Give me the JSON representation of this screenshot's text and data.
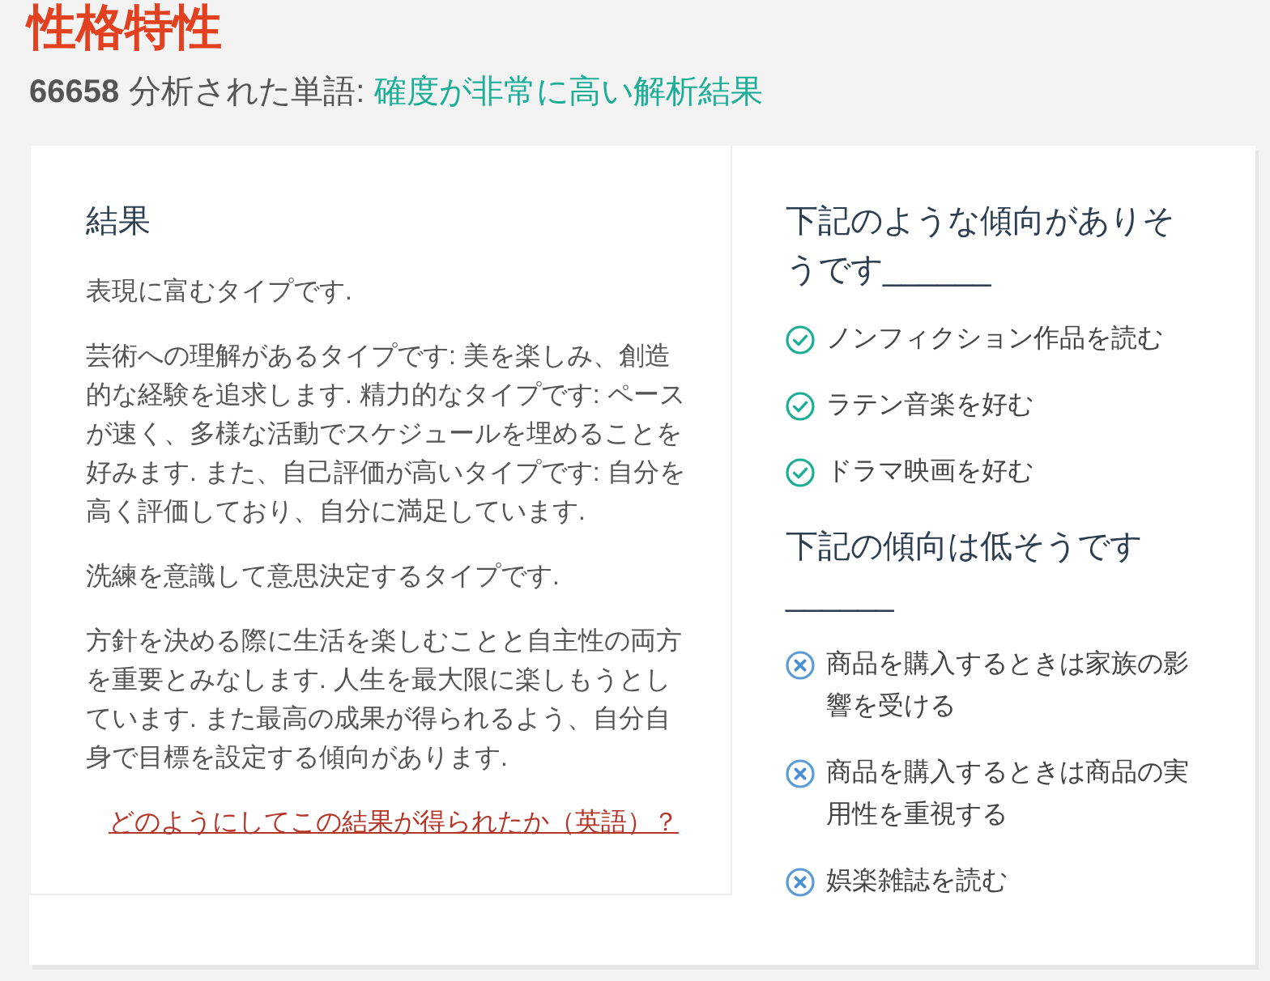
{
  "title": "性格特性",
  "summary": {
    "count": "66658",
    "label": "分析された単語:",
    "confidence": "確度が非常に高い解析結果"
  },
  "result": {
    "heading": "結果",
    "paragraphs": [
      "表現に富むタイプです.",
      "芸術への理解があるタイプです: 美を楽しみ、創造的な経験を追求します. 精力的なタイプです: ペースが速く、多様な活動でスケジュールを埋めることを好みます. また、自己評価が高いタイプです: 自分を高く評価しており、自分に満足しています.",
      "洗練を意識して意思決定するタイプです.",
      "方針を決める際に生活を楽しむことと自主性の両方を重要とみなします. 人生を最大限に楽しもうとしています. また最高の成果が得られるよう、自分自身で目標を設定する傾向があります."
    ],
    "link": "どのようにしてこの結果が得られたか（英語）？"
  },
  "trait_lists": [
    {
      "kind": "likely",
      "heading": "下記のような傾向がありそうです______",
      "items": [
        "ノンフィクション作品を読む",
        "ラテン音楽を好む",
        "ドラマ映画を好む"
      ]
    },
    {
      "kind": "unlikely",
      "heading": "下記の傾向は低そうです______",
      "items": [
        "商品を購入するときは家族の影響を受ける",
        "商品を購入するときは商品の実用性を重視する",
        "娯楽雑誌を読む"
      ]
    }
  ]
}
